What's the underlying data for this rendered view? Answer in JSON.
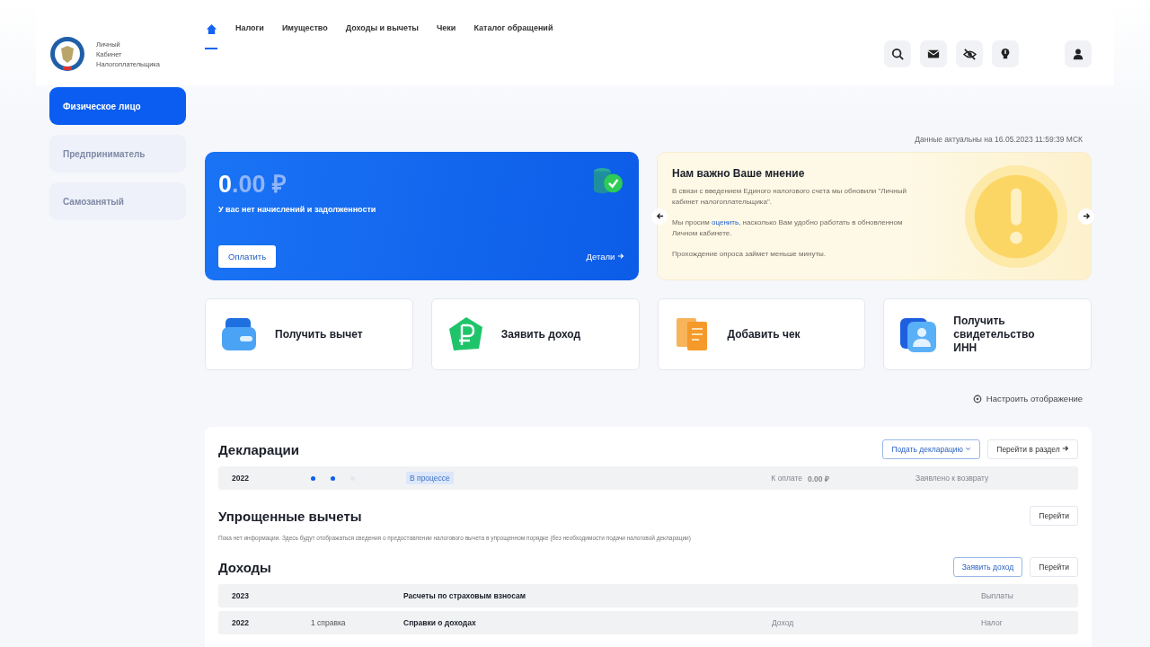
{
  "header": {
    "logo_text": [
      "Личный",
      "Кабинет",
      "Налогоплательщика"
    ],
    "nav": [
      {
        "kind": "home",
        "selected": true
      },
      {
        "label": "Налоги",
        "selected": false
      },
      {
        "label": "Имущество",
        "selected": false
      },
      {
        "label": "Доходы и вычеты",
        "selected": false
      },
      {
        "label": "Чеки",
        "selected": false
      },
      {
        "label": "Каталог обращений",
        "selected": false
      }
    ],
    "tools": [
      {
        "kind": "search"
      },
      {
        "kind": "mail"
      },
      {
        "kind": "eye-off"
      },
      {
        "kind": "bulb"
      },
      {
        "kind": "user"
      }
    ]
  },
  "sidebar": {
    "items": [
      {
        "label": "Физическое лицо",
        "selected": true
      },
      {
        "label": "Предприниматель",
        "selected": false
      },
      {
        "label": "Самозанятый",
        "selected": false
      }
    ]
  },
  "data_date": "Данные актуальны на 16.05.2023 11:59:39 МСК",
  "balance": {
    "amount_integer": "0",
    "amount_fraction": ".00 ₽",
    "caption": "У вас нет начислений и задолженности",
    "pay_button": "Оплатить",
    "details_link": "Детали"
  },
  "opinion": {
    "title": "Нам важно Ваше мнение",
    "paragraphs": [
      {
        "text": "В связи с введением Единого налогового счета мы обновили \"Личный кабинет налогоплательщика\"."
      },
      {
        "before": "Мы просим ",
        "link": "оценить",
        "after": ", насколько Вам удобно работать в обновленном Личном кабинете."
      },
      {
        "text": "Прохождение опроса займет меньше минуты."
      }
    ]
  },
  "actions": [
    {
      "kind": "wallet",
      "label": "Получить вычет"
    },
    {
      "kind": "ruble",
      "label": "Заявить доход"
    },
    {
      "kind": "receipt",
      "label": "Добавить чек"
    },
    {
      "kind": "id",
      "label": "Получить свидетельство ИНН"
    }
  ],
  "customize": "Настроить отображение",
  "declarations": {
    "title": "Декларации",
    "primary_button": "Подать декларацию",
    "section_button": "Перейти в раздел",
    "row": {
      "year": "2022",
      "steps": [
        {
          "done": true
        },
        {
          "done": true
        },
        {
          "done": false
        }
      ],
      "status": "В процессе",
      "to_pay_label": "К оплате",
      "to_pay": "0.00 ₽",
      "refund_label": "Заявлено к возврату"
    }
  },
  "simplified": {
    "title": "Упрощенные вычеты",
    "section_button": "Перейти",
    "note": "Пока нет информации. Здесь будут отображаться сведения о предоставлении налогового вычета в упрощенном порядке (без необходимости подачи налоговой декларации)"
  },
  "incomes": {
    "title": "Доходы",
    "primary_button": "Заявить доход",
    "section_button": "Перейти",
    "rows": [
      {
        "year": "2023",
        "name": "Расчеты по страховым взносам",
        "col_5": "Выплаты"
      },
      {
        "year": "2022",
        "count": "1 справка",
        "name": "Справки о доходах",
        "col_4": "Доход",
        "col_5": "Налог"
      }
    ]
  }
}
